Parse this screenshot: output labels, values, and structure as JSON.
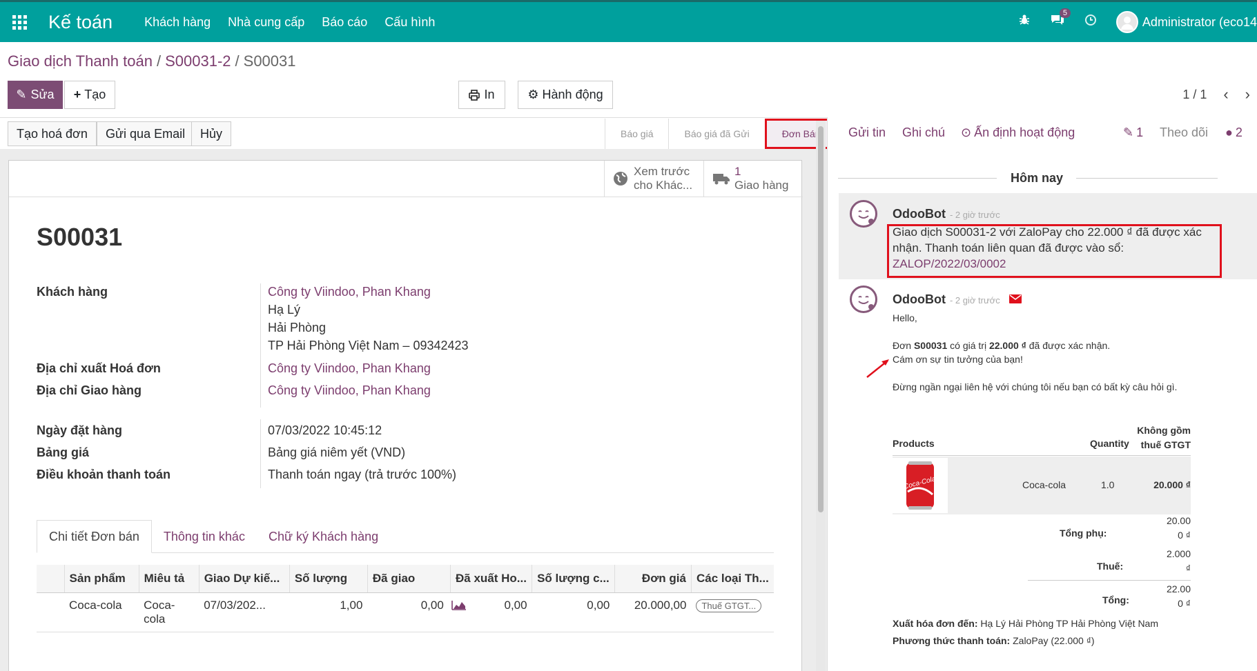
{
  "nav": {
    "brand": "Kế toán",
    "menu": [
      "Khách hàng",
      "Nhà cung cấp",
      "Báo cáo",
      "Cấu hình"
    ],
    "messages_badge": "5",
    "user": "Administrator (eco14"
  },
  "breadcrumb": {
    "part1": "Giao dịch Thanh toán",
    "part2": "S00031-2",
    "current": "S00031",
    "sep": "/"
  },
  "actions": {
    "edit": "Sửa",
    "create": "Tạo",
    "print": "In",
    "action": "Hành động"
  },
  "pager": {
    "value": "1 / 1"
  },
  "status_buttons": [
    "Tạo hoá đơn",
    "Gửi qua Email",
    "Hủy"
  ],
  "stages": [
    "Báo giá",
    "Báo giá đã Gửi",
    "Đơn Bán"
  ],
  "smart": {
    "preview_1": "Xem trước",
    "preview_2": "cho Khác...",
    "delivery_count": "1",
    "delivery_label": "Giao hàng"
  },
  "order": {
    "name": "S00031",
    "customer_label": "Khách hàng",
    "customer_name": "Công ty Viindoo, Phan Khang",
    "addr1": "Hạ Lý",
    "addr2": "Hải Phòng",
    "addr3": "TP Hải Phòng Việt Nam – 09342423",
    "invoice_label": "Địa chỉ xuất Hoá đơn",
    "invoice_value": "Công ty Viindoo, Phan Khang",
    "shipping_label": "Địa chỉ Giao hàng",
    "shipping_value": "Công ty Viindoo, Phan Khang",
    "date_label": "Ngày đặt hàng",
    "date_value": "07/03/2022 10:45:12",
    "pricelist_label": "Bảng giá",
    "pricelist_value": "Bảng giá niêm yết (VND)",
    "terms_label": "Điều khoản thanh toán",
    "terms_value": "Thanh toán ngay (trả trước 100%)"
  },
  "tabs": [
    "Chi tiết Đơn bán",
    "Thông tin khác",
    "Chữ ký Khách hàng"
  ],
  "lines": {
    "headers": [
      "Sản phẩm",
      "Miêu tả",
      "Giao Dự kiế...",
      "Số lượng",
      "Đã giao",
      "Đã xuất Ho...",
      "Số lượng c...",
      "Đơn giá",
      "Các loại Th..."
    ],
    "row": {
      "product": "Coca-cola",
      "desc1": "Coca-",
      "desc2": "cola",
      "date": "07/03/202...",
      "qty": "1,00",
      "delivered": "0,00",
      "invoiced": "0,00",
      "to_invoice": "0,00",
      "price": "20.000,00",
      "tax": "Thuế GTGT..."
    }
  },
  "chatter": {
    "send": "Gửi tin",
    "note": "Ghi chú",
    "schedule": "Ấn định hoạt động",
    "attachments": "1",
    "follow": "Theo dõi",
    "followers": "2",
    "today": "Hôm nay",
    "msg1": {
      "author": "OdooBot",
      "time": "- 2 giờ trước",
      "l1": "Giao dịch S00031-2 với ZaloPay cho 22.000 ₫ đã được xác",
      "l2": "nhận. Thanh toán liên quan đã được vào sổ:",
      "l3": "ZALOP/2022/03/0002"
    },
    "msg2": {
      "author": "OdooBot",
      "time": "- 2 giờ trước",
      "hello": "Hello,",
      "order_pre": "Đơn",
      "order_ref": "S00031",
      "order_mid": "có giá trị",
      "order_amount": "22.000 ₫",
      "order_post": "đã được xác nhận.",
      "thanks": "Cám ơn sự tin tưởng của bạn!",
      "contact": "Đừng ngần ngại liên hệ với chúng tôi nếu bạn có bất kỳ câu hỏi gì.",
      "col_products": "Products",
      "col_qty": "Quantity",
      "col_untaxed_1": "Không gồm",
      "col_untaxed_2": "thuế GTGT",
      "product": "Coca-cola",
      "qty": "1.0",
      "amount": "20.000 ₫",
      "can_text": "Coca-Cola",
      "subtotal_label": "Tổng phụ:",
      "subtotal_1": "20.00",
      "subtotal_2": "0 ₫",
      "tax_label": "Thuế:",
      "tax_1": "2.000",
      "tax_2": "₫",
      "total_label": "Tổng:",
      "total_1": "22.00",
      "total_2": "0 ₫",
      "invoice_addr_label": "Xuất hóa đơn đến:",
      "invoice_addr": "Hạ Lý Hải Phòng TP Hải Phòng Việt Nam",
      "payment_label": "Phương thức thanh toán:",
      "payment": "ZaloPay (22.000 ₫)"
    }
  },
  "colors": {
    "primary": "#00a09d",
    "accent": "#7c4c74",
    "link": "#7c3d6e",
    "highlight": "#e0101c"
  }
}
